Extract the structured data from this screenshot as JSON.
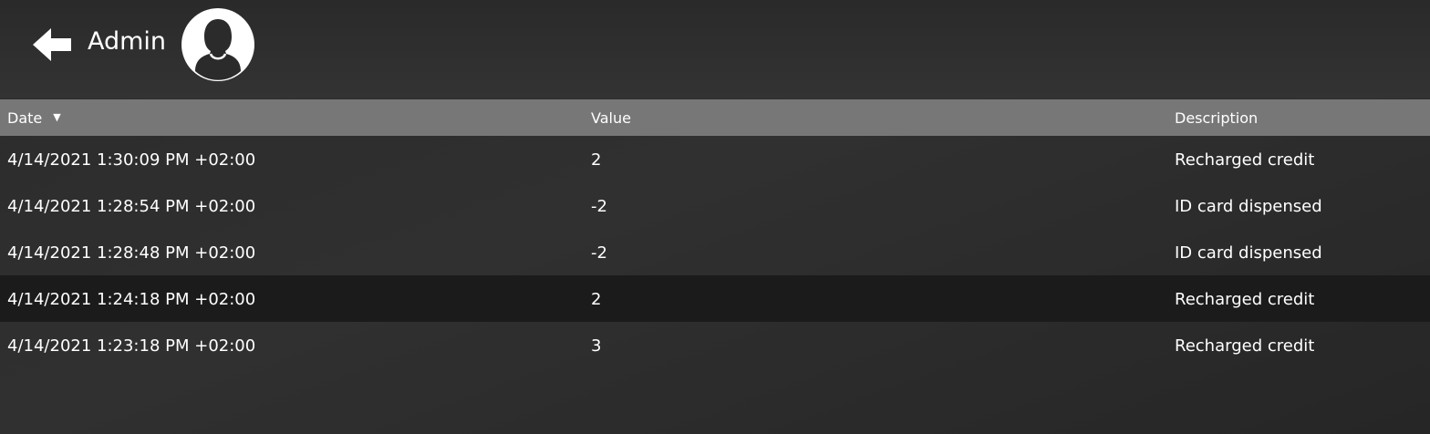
{
  "header": {
    "title": "Admin",
    "back_icon": "arrow-left-icon",
    "avatar_icon": "user-avatar-icon"
  },
  "table": {
    "columns": {
      "date": "Date",
      "value": "Value",
      "description": "Description"
    },
    "sort": {
      "column": "date",
      "direction": "descending",
      "icon": "sort-down-triangle-icon"
    },
    "rows": [
      {
        "date": "4/14/2021 1:30:09 PM +02:00",
        "value": "2",
        "description": "Recharged credit",
        "selected": false
      },
      {
        "date": "4/14/2021 1:28:54 PM +02:00",
        "value": "-2",
        "description": "ID card dispensed",
        "selected": false
      },
      {
        "date": "4/14/2021 1:28:48 PM +02:00",
        "value": "-2",
        "description": "ID card dispensed",
        "selected": false
      },
      {
        "date": "4/14/2021 1:24:18 PM +02:00",
        "value": "2",
        "description": "Recharged credit",
        "selected": true
      },
      {
        "date": "4/14/2021 1:23:18 PM +02:00",
        "value": "3",
        "description": "Recharged credit",
        "selected": false
      }
    ]
  },
  "colors": {
    "background": "#2d2d2d",
    "header_bar": "#777777",
    "selected_row": "#1b1b1b",
    "text": "#ffffff"
  }
}
